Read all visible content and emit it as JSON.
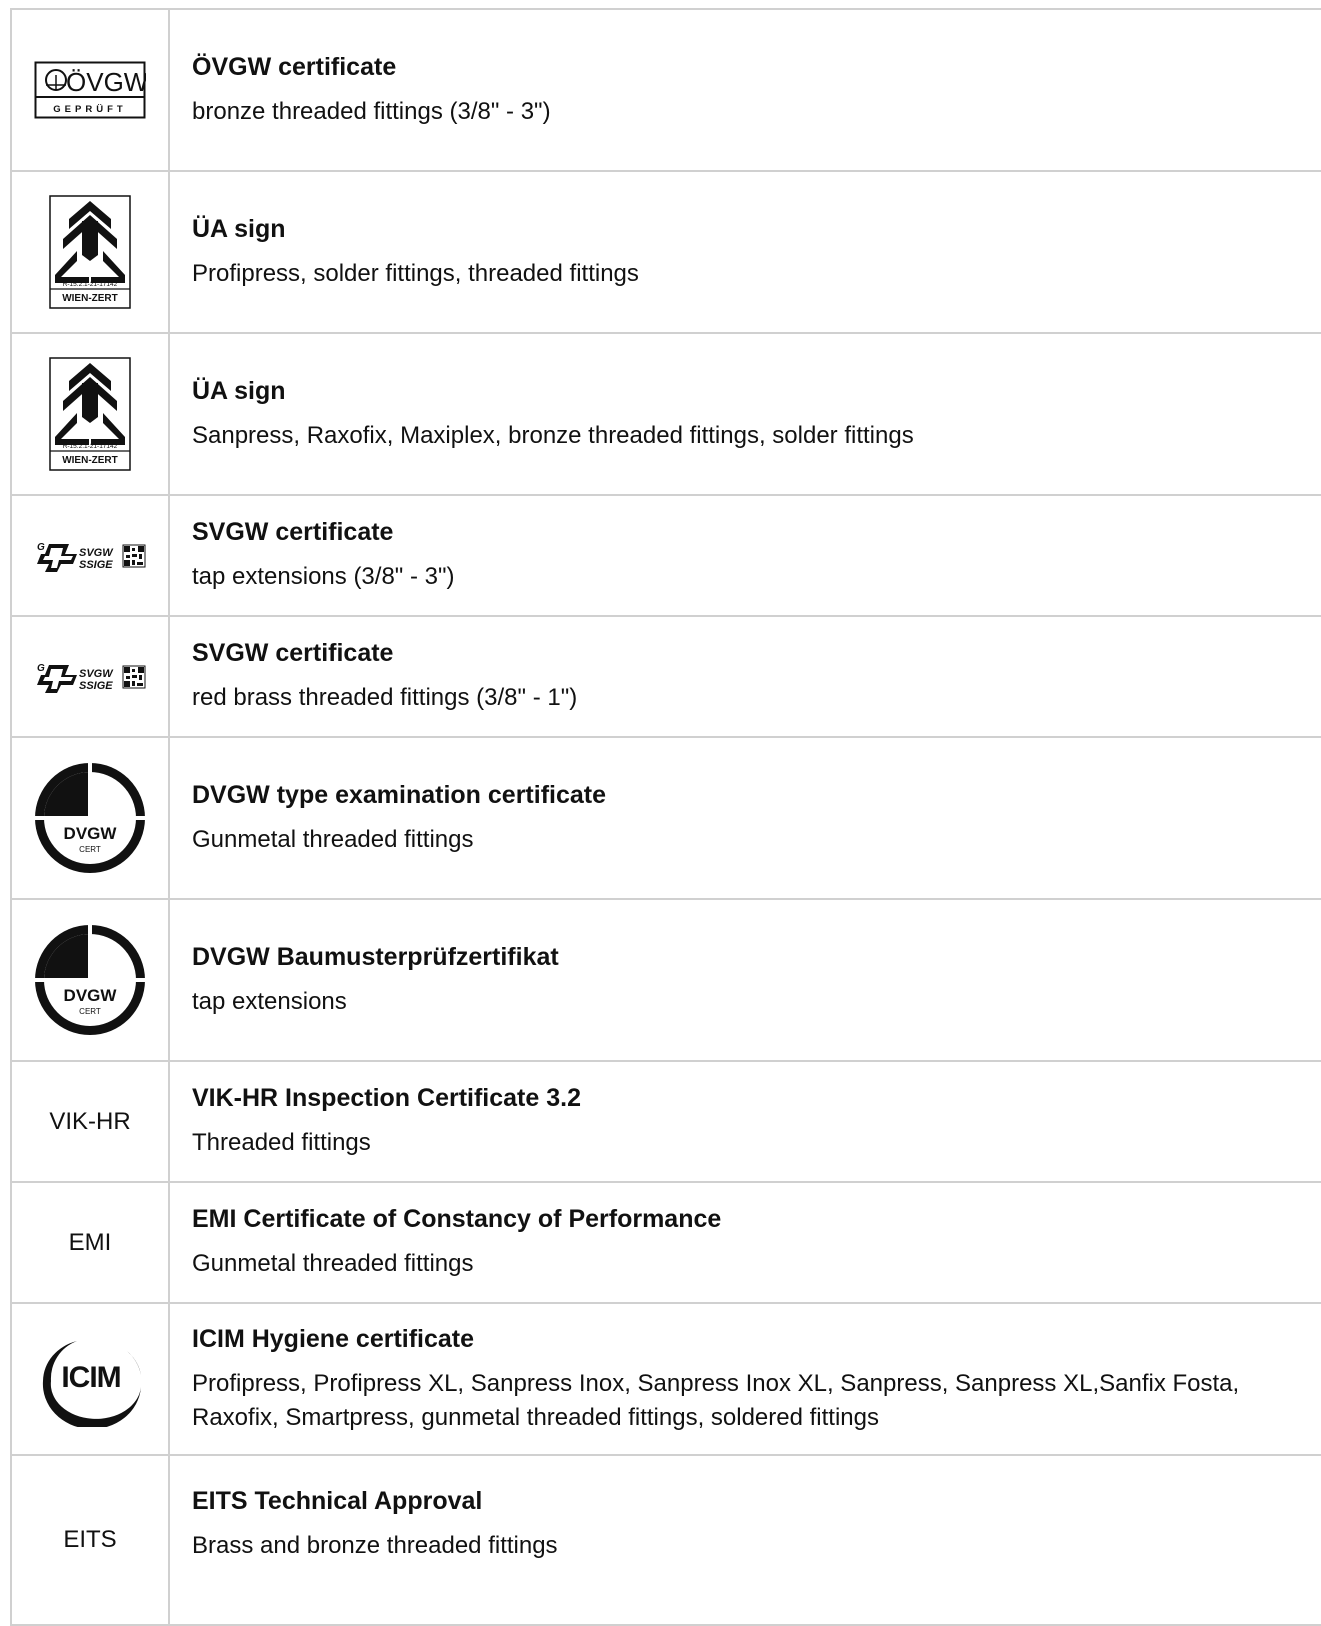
{
  "certificates": [
    {
      "logo": "ovgw-logo",
      "logo_text": [
        "ÖVGW",
        "GEPRÜFT"
      ],
      "title": "ÖVGW certificate",
      "description": "bronze threaded fittings (3/8\" - 3\")"
    },
    {
      "logo": "ua-wien-zert-logo",
      "logo_text": [
        "R-15.2.1-21-17142",
        "WIEN-ZERT"
      ],
      "title": "ÜA sign",
      "description": "Profipress, solder fittings, threaded fittings"
    },
    {
      "logo": "ua-wien-zert-logo",
      "logo_text": [
        "R-15.2.1-21-17142",
        "WIEN-ZERT"
      ],
      "title": "ÜA sign",
      "description": "Sanpress, Raxofix, Maxiplex, bronze threaded fittings, solder fittings"
    },
    {
      "logo": "svgw-logo",
      "logo_text": [
        "G",
        "SVGW",
        "SSIGE"
      ],
      "title": "SVGW certificate",
      "description": "tap extensions (3/8\" - 3\")"
    },
    {
      "logo": "svgw-logo",
      "logo_text": [
        "G",
        "SVGW",
        "SSIGE"
      ],
      "title": "SVGW certificate",
      "description": "red brass threaded fittings (3/8\" - 1\")"
    },
    {
      "logo": "dvgw-cert-logo",
      "logo_text": [
        "DVGW",
        "CERT"
      ],
      "title": "DVGW type examination certificate",
      "description": "Gunmetal threaded fittings"
    },
    {
      "logo": "dvgw-cert-logo",
      "logo_text": [
        "DVGW",
        "CERT"
      ],
      "title": "DVGW Baumusterprüfzertifikat",
      "description": "tap extensions"
    },
    {
      "logo": "text",
      "logo_text": [
        "VIK-HR"
      ],
      "title": "VIK-HR Inspection Certificate 3.2",
      "description": "Threaded fittings"
    },
    {
      "logo": "text",
      "logo_text": [
        "EMI"
      ],
      "title": "EMI Certificate of Constancy of Performance",
      "description": "Gunmetal threaded fittings"
    },
    {
      "logo": "icim-logo",
      "logo_text": [
        "ICIM"
      ],
      "title": "ICIM Hygiene certificate",
      "description": "Profipress, Profipress XL, Sanpress Inox, Sanpress Inox XL, Sanpress, Sanpress XL,Sanfix Fosta, Raxofix, Smartpress, gunmetal threaded fittings, soldered fittings"
    },
    {
      "logo": "text",
      "logo_text": [
        "EITS"
      ],
      "title": "EITS Technical Approval",
      "description": "Brass and bronze threaded fittings"
    }
  ]
}
